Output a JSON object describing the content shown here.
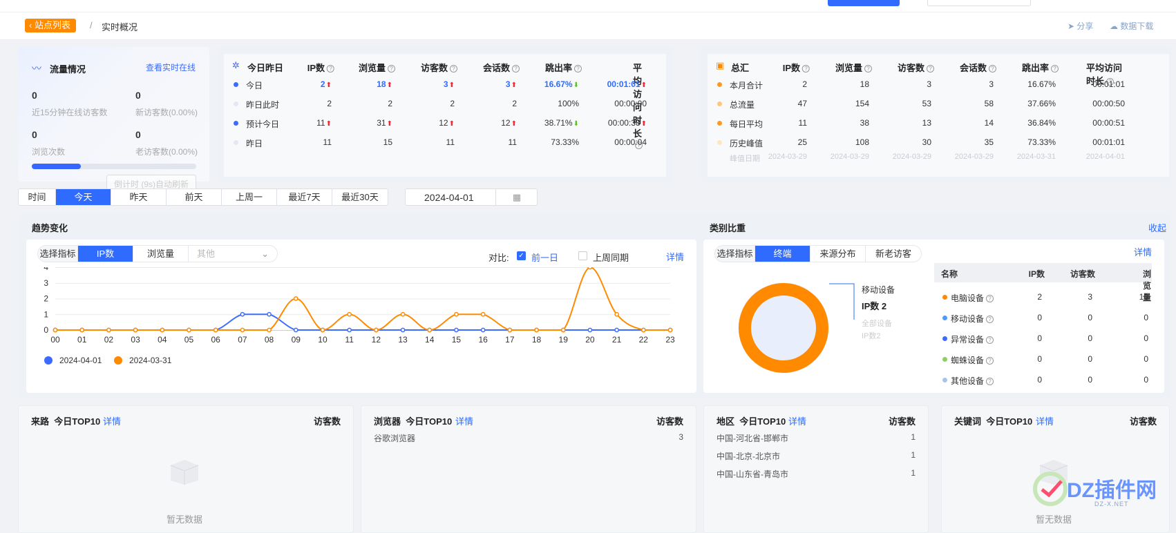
{
  "header": {
    "site_list_label": "站点列表",
    "separator": "/",
    "current_page": "实时概况",
    "share_label": "分享",
    "download_label": "数据下载"
  },
  "traffic": {
    "title": "流量情况",
    "realtime_link": "查看实时在线",
    "online_15min": {
      "value": "0",
      "label": "近15分钟在线访客数"
    },
    "new_visitors": {
      "value": "0",
      "label": "新访客数(0.00%)"
    },
    "views": {
      "value": "0",
      "label": "浏览次数"
    },
    "old_visitors": {
      "value": "0",
      "label": "老访客数(0.00%)"
    },
    "progress_fraction": 0.3,
    "countdown": "倒计时 (9s)自动刷新"
  },
  "today_table": {
    "title": "今日昨日",
    "columns": [
      "IP数",
      "浏览量",
      "访客数",
      "会话数",
      "跳出率",
      "平均访问时长"
    ],
    "rows": [
      {
        "label": "今日",
        "dot": "#3d6bff",
        "cells": [
          "2",
          "18",
          "3",
          "3",
          "16.67%",
          "00:01:01"
        ],
        "arrows": [
          "up",
          "up",
          "up",
          "up",
          "down",
          "up"
        ],
        "highlight": true
      },
      {
        "label": "昨日此时",
        "dot": "#e4e8f5",
        "cells": [
          "2",
          "2",
          "2",
          "2",
          "100%",
          "00:00:00"
        ],
        "arrows": [
          "",
          "",
          "",
          "",
          "",
          ""
        ],
        "highlight": false
      },
      {
        "label": "预计今日",
        "dot": "#3d6bff",
        "cells": [
          "11",
          "31",
          "12",
          "12",
          "38.71%",
          "00:00:38"
        ],
        "arrows": [
          "up",
          "up",
          "up",
          "up",
          "down",
          "up"
        ],
        "highlight": false
      },
      {
        "label": "昨日",
        "dot": "#e4e8f5",
        "cells": [
          "11",
          "15",
          "11",
          "11",
          "73.33%",
          "00:00:04"
        ],
        "arrows": [
          "",
          "",
          "",
          "",
          "",
          ""
        ],
        "highlight": false
      }
    ]
  },
  "total_table": {
    "title": "总汇",
    "columns": [
      "IP数",
      "浏览量",
      "访客数",
      "会话数",
      "跳出率",
      "平均访问时长"
    ],
    "rows": [
      {
        "label": "本月合计",
        "dot": "#ff9a1f",
        "cells": [
          "2",
          "18",
          "3",
          "3",
          "16.67%",
          "00:01:01"
        ]
      },
      {
        "label": "总流量",
        "dot": "#ffc875",
        "cells": [
          "47",
          "154",
          "53",
          "58",
          "37.66%",
          "00:00:50"
        ]
      },
      {
        "label": "每日平均",
        "dot": "#ff9a1f",
        "cells": [
          "11",
          "38",
          "13",
          "14",
          "36.84%",
          "00:00:51"
        ]
      },
      {
        "label": "历史峰值",
        "dot": "#ffe6bf",
        "cells": [
          "25",
          "108",
          "30",
          "35",
          "73.33%",
          "00:01:01"
        ]
      }
    ],
    "peak_label": "峰值日期",
    "peak_dates": [
      "2024-03-29",
      "2024-03-29",
      "2024-03-29",
      "2024-03-29",
      "2024-03-31",
      "2024-04-01"
    ]
  },
  "time_tabs": [
    "时间",
    "今天",
    "昨天",
    "前天",
    "上周一",
    "最近7天",
    "最近30天"
  ],
  "time_tabs_active": 1,
  "date_value": "2024-04-01",
  "trend": {
    "title": "趋势变化",
    "metric_label": "选择指标",
    "metric_tabs": [
      "IP数",
      "浏览量"
    ],
    "metric_active": 0,
    "metric_select_placeholder": "其他",
    "compare_label": "对比:",
    "compare_prev_day": "前一日",
    "compare_last_week": "上周同期",
    "detail": "详情",
    "collapse": "收起"
  },
  "chart_data": {
    "type": "line",
    "title": "",
    "xlabel": "",
    "ylabel": "",
    "x": [
      "00",
      "01",
      "02",
      "03",
      "04",
      "05",
      "06",
      "07",
      "08",
      "09",
      "10",
      "11",
      "12",
      "13",
      "14",
      "15",
      "16",
      "17",
      "18",
      "19",
      "20",
      "21",
      "22",
      "23"
    ],
    "ylim": [
      0,
      4
    ],
    "yticks": [
      "0",
      "1",
      "2",
      "3",
      "4"
    ],
    "series": [
      {
        "name": "2024-04-01",
        "color": "#3d6bff",
        "values": [
          0,
          0,
          0,
          0,
          0,
          0,
          0,
          1,
          1,
          0,
          0,
          0,
          0,
          0,
          0,
          0,
          0,
          0,
          0,
          0,
          0,
          0,
          0,
          0
        ]
      },
      {
        "name": "2024-03-31",
        "color": "#ff8a00",
        "values": [
          0,
          0,
          0,
          0,
          0,
          0,
          0,
          0,
          0,
          2,
          0,
          1,
          0,
          1,
          0,
          1,
          1,
          0,
          0,
          0,
          4,
          1,
          0,
          0
        ]
      }
    ],
    "legend_position": "bottom-left",
    "grid": true
  },
  "category": {
    "title": "类别比重",
    "metric_label": "选择指标",
    "tabs": [
      "终端",
      "来源分布",
      "新老访客"
    ],
    "tab_active": 0,
    "detail": "详情",
    "donut_label": "移动设备",
    "donut_value": "IP数 2",
    "donut_sub1": "全部设备",
    "donut_sub2": "IP数2",
    "table_columns": [
      "名称",
      "IP数",
      "访客数",
      "浏览量"
    ],
    "rows": [
      {
        "name": "电脑设备",
        "dot": "#ff8a00",
        "values": [
          "2",
          "3",
          "18"
        ]
      },
      {
        "name": "移动设备",
        "dot": "#4e9cf5",
        "values": [
          "0",
          "0",
          "0"
        ]
      },
      {
        "name": "异常设备",
        "dot": "#3d6bff",
        "values": [
          "0",
          "0",
          "0"
        ]
      },
      {
        "name": "蜘蛛设备",
        "dot": "#8ccf62",
        "values": [
          "0",
          "0",
          "0"
        ]
      },
      {
        "name": "其他设备",
        "dot": "#a9c4ec",
        "values": [
          "0",
          "0",
          "0"
        ]
      }
    ]
  },
  "bottom": [
    {
      "title": "来路",
      "sub": "今日TOP10",
      "detail": "详情",
      "right": "访客数",
      "rows": [],
      "empty": "暂无数据"
    },
    {
      "title": "浏览器",
      "sub": "今日TOP10",
      "detail": "详情",
      "right": "访客数",
      "rows": [
        {
          "name": "谷歌浏览器",
          "value": "3"
        }
      ]
    },
    {
      "title": "地区",
      "sub": "今日TOP10",
      "detail": "详情",
      "right": "访客数",
      "rows": [
        {
          "name": "中国-河北省-邯郸市",
          "value": "1"
        },
        {
          "name": "中国-北京-北京市",
          "value": "1"
        },
        {
          "name": "中国-山东省-青岛市",
          "value": "1"
        }
      ]
    },
    {
      "title": "关键词",
      "sub": "今日TOP10",
      "detail": "详情",
      "right": "访客数",
      "rows": [],
      "empty": "暂无数据"
    }
  ],
  "watermark": {
    "brand": "DZ插件网",
    "url": "DZ-X.NET"
  }
}
